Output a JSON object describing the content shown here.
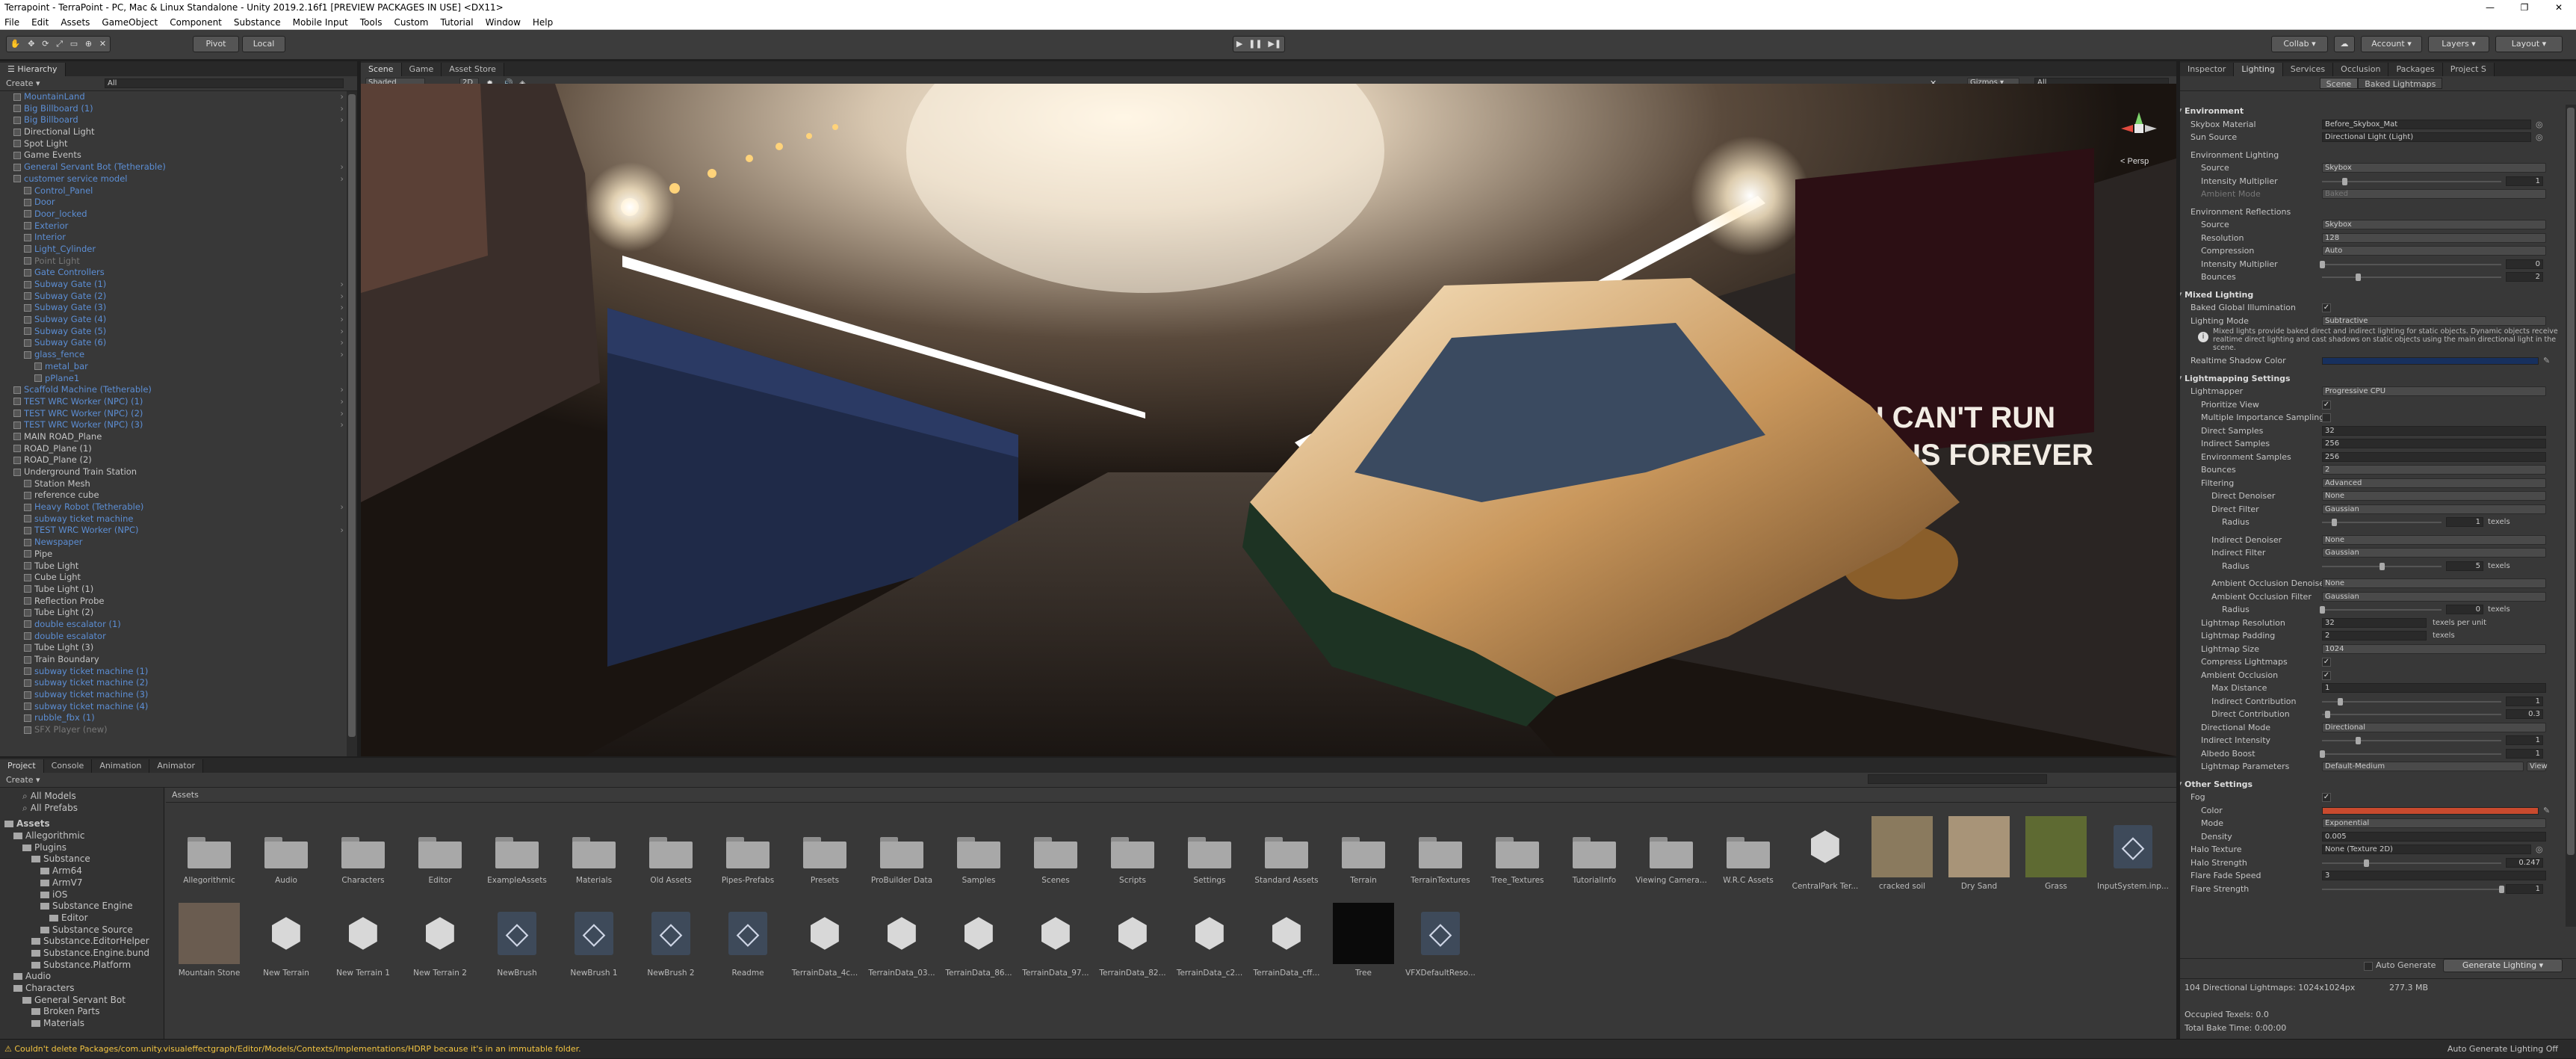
{
  "window": {
    "title": "Terrapoint - TerraPoint - PC, Mac & Linux Standalone - Unity 2019.2.16f1 [PREVIEW PACKAGES IN USE] <DX11>",
    "minimize": "—",
    "maximize": "❐",
    "close": "✕"
  },
  "menu": [
    "File",
    "Edit",
    "Assets",
    "GameObject",
    "Component",
    "Substance",
    "Mobile Input",
    "Tools",
    "Custom",
    "Tutorial",
    "Window",
    "Help"
  ],
  "toolbar": {
    "pivot": "Pivot",
    "local": "Local",
    "collab": "Collab ▾",
    "account": "Account ▾",
    "layers": "Layers ▾",
    "layout": "Layout ▾"
  },
  "hierarchy": {
    "tab": "Hierarchy",
    "create": "Create ▾",
    "search_placeholder": "All",
    "rows": [
      {
        "t": "MountainLand",
        "s": "blue",
        "d": 1,
        "arr": true
      },
      {
        "t": "Big Billboard (1)",
        "s": "blue",
        "d": 1,
        "arr": true
      },
      {
        "t": "Big Billboard",
        "s": "blue",
        "d": 1,
        "arr": true
      },
      {
        "t": "Directional Light",
        "s": "",
        "d": 1
      },
      {
        "t": "Spot Light",
        "s": "",
        "d": 1
      },
      {
        "t": "Game Events",
        "s": "",
        "d": 1
      },
      {
        "t": "General Servant Bot (Tetherable)",
        "s": "blue",
        "d": 1,
        "arr": true
      },
      {
        "t": "customer service model",
        "s": "blue",
        "d": 1,
        "arr": true
      },
      {
        "t": "Control_Panel",
        "s": "blue",
        "d": 2
      },
      {
        "t": "Door",
        "s": "blue",
        "d": 2
      },
      {
        "t": "Door_locked",
        "s": "blue",
        "d": 2
      },
      {
        "t": "Exterior",
        "s": "blue",
        "d": 2
      },
      {
        "t": "Interior",
        "s": "blue",
        "d": 2
      },
      {
        "t": "Light_Cylinder",
        "s": "blue",
        "d": 2
      },
      {
        "t": "Point Light",
        "s": "dim",
        "d": 2
      },
      {
        "t": "Gate Controllers",
        "s": "blue",
        "d": 2
      },
      {
        "t": "Subway Gate (1)",
        "s": "blue",
        "d": 2,
        "arr": true
      },
      {
        "t": "Subway Gate (2)",
        "s": "blue",
        "d": 2,
        "arr": true
      },
      {
        "t": "Subway Gate (3)",
        "s": "blue",
        "d": 2,
        "arr": true
      },
      {
        "t": "Subway Gate (4)",
        "s": "blue",
        "d": 2,
        "arr": true
      },
      {
        "t": "Subway Gate (5)",
        "s": "blue",
        "d": 2,
        "arr": true
      },
      {
        "t": "Subway Gate (6)",
        "s": "blue",
        "d": 2,
        "arr": true
      },
      {
        "t": "glass_fence",
        "s": "blue",
        "d": 2,
        "arr": true
      },
      {
        "t": "metal_bar",
        "s": "blue",
        "d": 3
      },
      {
        "t": "pPlane1",
        "s": "blue",
        "d": 3
      },
      {
        "t": "Scaffold Machine (Tetherable)",
        "s": "blue",
        "d": 1,
        "arr": true
      },
      {
        "t": "TEST WRC Worker (NPC) (1)",
        "s": "blue",
        "d": 1,
        "arr": true
      },
      {
        "t": "TEST WRC Worker (NPC) (2)",
        "s": "blue",
        "d": 1,
        "arr": true
      },
      {
        "t": "TEST WRC Worker (NPC) (3)",
        "s": "blue",
        "d": 1,
        "arr": true
      },
      {
        "t": "MAIN ROAD_Plane",
        "s": "",
        "d": 1
      },
      {
        "t": "ROAD_Plane (1)",
        "s": "",
        "d": 1
      },
      {
        "t": "ROAD_Plane (2)",
        "s": "",
        "d": 1
      },
      {
        "t": "Underground Train Station",
        "s": "",
        "d": 1
      },
      {
        "t": "Station Mesh",
        "s": "",
        "d": 2
      },
      {
        "t": "reference cube",
        "s": "",
        "d": 2
      },
      {
        "t": "Heavy Robot (Tetherable)",
        "s": "blue",
        "d": 2,
        "arr": true
      },
      {
        "t": "subway ticket machine",
        "s": "blue",
        "d": 2
      },
      {
        "t": "TEST WRC Worker (NPC)",
        "s": "blue",
        "d": 2,
        "arr": true
      },
      {
        "t": "Newspaper",
        "s": "blue",
        "d": 2
      },
      {
        "t": "Pipe",
        "s": "",
        "d": 2
      },
      {
        "t": "Tube Light",
        "s": "",
        "d": 2
      },
      {
        "t": "Cube Light",
        "s": "",
        "d": 2
      },
      {
        "t": "Tube Light (1)",
        "s": "",
        "d": 2
      },
      {
        "t": "Reflection Probe",
        "s": "",
        "d": 2
      },
      {
        "t": "Tube Light (2)",
        "s": "",
        "d": 2
      },
      {
        "t": "double escalator (1)",
        "s": "blue",
        "d": 2
      },
      {
        "t": "double escalator",
        "s": "blue",
        "d": 2
      },
      {
        "t": "Tube Light (3)",
        "s": "",
        "d": 2
      },
      {
        "t": "Train Boundary",
        "s": "",
        "d": 2
      },
      {
        "t": "subway ticket machine (1)",
        "s": "blue",
        "d": 2
      },
      {
        "t": "subway ticket machine (2)",
        "s": "blue",
        "d": 2
      },
      {
        "t": "subway ticket machine (3)",
        "s": "blue",
        "d": 2
      },
      {
        "t": "subway ticket machine (4)",
        "s": "blue",
        "d": 2
      },
      {
        "t": "rubble_fbx (1)",
        "s": "blue",
        "d": 2
      },
      {
        "t": "SFX Player (new)",
        "s": "dim",
        "d": 2
      }
    ]
  },
  "scene": {
    "tabs": [
      "Scene",
      "Game",
      "Asset Store"
    ],
    "shaded": "Shaded",
    "mode_2d": "2D",
    "gizmos": "Gizmos ▾",
    "search_placeholder": "All",
    "persp": "< Persp",
    "billboard_line1": "YOU CAN'T RUN",
    "billboard_line2": "FROM US FOREVER"
  },
  "project": {
    "tabs": [
      "Project",
      "Console",
      "Animation",
      "Animator"
    ],
    "create": "Create ▾",
    "favorites": [
      "All Models",
      "All Prefabs"
    ],
    "tree": [
      {
        "t": "Assets",
        "d": 0,
        "b": true
      },
      {
        "t": "Allegorithmic",
        "d": 1
      },
      {
        "t": "Plugins",
        "d": 2
      },
      {
        "t": "Substance",
        "d": 3
      },
      {
        "t": "Arm64",
        "d": 4
      },
      {
        "t": "ArmV7",
        "d": 4
      },
      {
        "t": "iOS",
        "d": 4
      },
      {
        "t": "Substance Engine",
        "d": 4
      },
      {
        "t": "Editor",
        "d": 5
      },
      {
        "t": "Substance Source",
        "d": 4
      },
      {
        "t": "Substance.EditorHelper",
        "d": 3
      },
      {
        "t": "Substance.Engine.bund",
        "d": 3
      },
      {
        "t": "Substance.Platform",
        "d": 3
      },
      {
        "t": "Audio",
        "d": 1
      },
      {
        "t": "Characters",
        "d": 1
      },
      {
        "t": "General Servant Bot",
        "d": 2
      },
      {
        "t": "Broken Parts",
        "d": 3
      },
      {
        "t": "Materials",
        "d": 3
      }
    ],
    "breadcrumb": "Assets",
    "assets_row1": [
      {
        "n": "Allegorithmic",
        "k": "folder"
      },
      {
        "n": "Audio",
        "k": "folder"
      },
      {
        "n": "Characters",
        "k": "folder"
      },
      {
        "n": "Editor",
        "k": "folder"
      },
      {
        "n": "ExampleAssets",
        "k": "folder"
      },
      {
        "n": "Materials",
        "k": "folder"
      },
      {
        "n": "Old Assets",
        "k": "folder"
      },
      {
        "n": "Pipes-Prefabs",
        "k": "folder"
      },
      {
        "n": "Presets",
        "k": "folder"
      },
      {
        "n": "ProBuilder Data",
        "k": "folder"
      },
      {
        "n": "Samples",
        "k": "folder"
      },
      {
        "n": "Scenes",
        "k": "folder"
      },
      {
        "n": "Scripts",
        "k": "folder"
      },
      {
        "n": "Settings",
        "k": "folder"
      },
      {
        "n": "Standard Assets",
        "k": "folder"
      },
      {
        "n": "Terrain",
        "k": "folder"
      },
      {
        "n": "TerrainTextures",
        "k": "folder"
      },
      {
        "n": "Tree_Textures",
        "k": "folder"
      },
      {
        "n": "TutorialInfo",
        "k": "folder"
      },
      {
        "n": "Viewing Camera...",
        "k": "folder"
      },
      {
        "n": "W.R.C Assets",
        "k": "folder"
      },
      {
        "n": "CentralPark Ter...",
        "k": "cube"
      },
      {
        "n": "cracked soil",
        "k": "soil"
      },
      {
        "n": "Dry Sand",
        "k": "sand"
      },
      {
        "n": "Grass",
        "k": "grass"
      },
      {
        "n": "InputSystem.inp...",
        "k": "unity"
      }
    ],
    "assets_row2": [
      {
        "n": "Mountain Stone",
        "k": "stone"
      },
      {
        "n": "New Terrain",
        "k": "cube"
      },
      {
        "n": "New Terrain 1",
        "k": "cube"
      },
      {
        "n": "New Terrain 2",
        "k": "cube"
      },
      {
        "n": "NewBrush",
        "k": "unity"
      },
      {
        "n": "NewBrush 1",
        "k": "unity"
      },
      {
        "n": "NewBrush 2",
        "k": "unity"
      },
      {
        "n": "Readme",
        "k": "unity"
      },
      {
        "n": "TerrainData_4c...",
        "k": "cube"
      },
      {
        "n": "TerrainData_03...",
        "k": "cube"
      },
      {
        "n": "TerrainData_86...",
        "k": "cube"
      },
      {
        "n": "TerrainData_97...",
        "k": "cube"
      },
      {
        "n": "TerrainData_82...",
        "k": "cube"
      },
      {
        "n": "TerrainData_c2...",
        "k": "cube"
      },
      {
        "n": "TerrainData_cff...",
        "k": "cube"
      },
      {
        "n": "Tree",
        "k": "black"
      },
      {
        "n": "VFXDefaultReso...",
        "k": "unity"
      }
    ]
  },
  "inspector": {
    "tabs": [
      "Inspector",
      "Lighting",
      "Services",
      "Occlusion",
      "Packages",
      "Project S"
    ],
    "subtabs": [
      "Scene",
      "Baked Lightmaps"
    ],
    "rows": [
      {
        "k": "h",
        "t": "Environment"
      },
      {
        "k": "r",
        "t": "Skybox Material",
        "v": "Before_Skybox_Mat",
        "ctl": "obj"
      },
      {
        "k": "r",
        "t": "Sun Source",
        "v": "Directional Light (Light)",
        "ctl": "obj"
      },
      {
        "k": "g"
      },
      {
        "k": "s",
        "t": "Environment Lighting"
      },
      {
        "k": "r",
        "i": 1,
        "t": "Source",
        "v": "Skybox",
        "ctl": "dd"
      },
      {
        "k": "r",
        "i": 1,
        "t": "Intensity Multiplier",
        "v": "1",
        "ctl": "sl",
        "p": 0.125
      },
      {
        "k": "r",
        "i": 1,
        "t": "Ambient Mode",
        "v": "Baked",
        "ctl": "dd",
        "dim": true
      },
      {
        "k": "g"
      },
      {
        "k": "s",
        "t": "Environment Reflections"
      },
      {
        "k": "r",
        "i": 1,
        "t": "Source",
        "v": "Skybox",
        "ctl": "dd"
      },
      {
        "k": "r",
        "i": 1,
        "t": "Resolution",
        "v": "128",
        "ctl": "dd"
      },
      {
        "k": "r",
        "i": 1,
        "t": "Compression",
        "v": "Auto",
        "ctl": "dd"
      },
      {
        "k": "r",
        "i": 1,
        "t": "Intensity Multiplier",
        "v": "0",
        "ctl": "sl",
        "p": 0.0
      },
      {
        "k": "r",
        "i": 1,
        "t": "Bounces",
        "v": "2",
        "ctl": "sl",
        "p": 0.2
      },
      {
        "k": "g"
      },
      {
        "k": "h",
        "t": "Mixed Lighting"
      },
      {
        "k": "r",
        "t": "Baked Global Illumination",
        "v": "✓",
        "ctl": "chk"
      },
      {
        "k": "r",
        "t": "Lighting Mode",
        "v": "Subtractive",
        "ctl": "dd"
      },
      {
        "k": "info",
        "t": "Mixed lights provide baked direct and indirect lighting for static objects. Dynamic objects receive realtime direct lighting and cast shadows on static objects using the main directional light in the scene."
      },
      {
        "k": "r",
        "t": "Realtime Shadow Color",
        "v": "",
        "ctl": "color",
        "c": "#17305e"
      },
      {
        "k": "g"
      },
      {
        "k": "h",
        "t": "Lightmapping Settings"
      },
      {
        "k": "r",
        "t": "Lightmapper",
        "v": "Progressive CPU",
        "ctl": "dd"
      },
      {
        "k": "r",
        "i": 1,
        "t": "Prioritize View",
        "v": "✓",
        "ctl": "chk"
      },
      {
        "k": "r",
        "i": 1,
        "t": "Multiple Importance Sampling",
        "v": "",
        "ctl": "chk"
      },
      {
        "k": "r",
        "i": 1,
        "t": "Direct Samples",
        "v": "32",
        "ctl": "fld"
      },
      {
        "k": "r",
        "i": 1,
        "t": "Indirect Samples",
        "v": "256",
        "ctl": "fld"
      },
      {
        "k": "r",
        "i": 1,
        "t": "Environment Samples",
        "v": "256",
        "ctl": "fld"
      },
      {
        "k": "r",
        "i": 1,
        "t": "Bounces",
        "v": "2",
        "ctl": "dd"
      },
      {
        "k": "r",
        "i": 1,
        "t": "Filtering",
        "v": "Advanced",
        "ctl": "dd"
      },
      {
        "k": "r",
        "i": 2,
        "t": "Direct Denoiser",
        "v": "None",
        "ctl": "dd"
      },
      {
        "k": "r",
        "i": 2,
        "t": "Direct Filter",
        "v": "Gaussian",
        "ctl": "dd"
      },
      {
        "k": "r",
        "i": 3,
        "t": "Radius",
        "v": "1",
        "ctl": "slu",
        "p": 0.1,
        "u": "texels"
      },
      {
        "k": "g"
      },
      {
        "k": "r",
        "i": 2,
        "t": "Indirect Denoiser",
        "v": "None",
        "ctl": "dd"
      },
      {
        "k": "r",
        "i": 2,
        "t": "Indirect Filter",
        "v": "Gaussian",
        "ctl": "dd"
      },
      {
        "k": "r",
        "i": 3,
        "t": "Radius",
        "v": "5",
        "ctl": "slu",
        "p": 0.5,
        "u": "texels"
      },
      {
        "k": "g"
      },
      {
        "k": "r",
        "i": 2,
        "t": "Ambient Occlusion Denoiser",
        "v": "None",
        "ctl": "dd"
      },
      {
        "k": "r",
        "i": 2,
        "t": "Ambient Occlusion Filter",
        "v": "Gaussian",
        "ctl": "dd"
      },
      {
        "k": "r",
        "i": 3,
        "t": "Radius",
        "v": "0",
        "ctl": "slu",
        "p": 0.0,
        "u": "texels"
      },
      {
        "k": "r",
        "i": 1,
        "t": "Lightmap Resolution",
        "v": "32",
        "ctl": "fldu",
        "u": "texels per unit"
      },
      {
        "k": "r",
        "i": 1,
        "t": "Lightmap Padding",
        "v": "2",
        "ctl": "fldu",
        "u": "texels"
      },
      {
        "k": "r",
        "i": 1,
        "t": "Lightmap Size",
        "v": "1024",
        "ctl": "dd"
      },
      {
        "k": "r",
        "i": 1,
        "t": "Compress Lightmaps",
        "v": "✓",
        "ctl": "chk"
      },
      {
        "k": "r",
        "i": 1,
        "t": "Ambient Occlusion",
        "v": "✓",
        "ctl": "chk"
      },
      {
        "k": "r",
        "i": 2,
        "t": "Max Distance",
        "v": "1",
        "ctl": "fld"
      },
      {
        "k": "r",
        "i": 2,
        "t": "Indirect Contribution",
        "v": "1",
        "ctl": "sl",
        "p": 0.1
      },
      {
        "k": "r",
        "i": 2,
        "t": "Direct Contribution",
        "v": "0.3",
        "ctl": "sl",
        "p": 0.03
      },
      {
        "k": "r",
        "i": 1,
        "t": "Directional Mode",
        "v": "Directional",
        "ctl": "dd"
      },
      {
        "k": "r",
        "i": 1,
        "t": "Indirect Intensity",
        "v": "1",
        "ctl": "sl",
        "p": 0.2
      },
      {
        "k": "r",
        "i": 1,
        "t": "Albedo Boost",
        "v": "1",
        "ctl": "sl",
        "p": 0.0
      },
      {
        "k": "r",
        "i": 1,
        "t": "Lightmap Parameters",
        "v": "Default-Medium",
        "ctl": "ddv"
      },
      {
        "k": "g"
      },
      {
        "k": "h",
        "t": "Other Settings"
      },
      {
        "k": "r",
        "t": "Fog",
        "v": "✓",
        "ctl": "chk"
      },
      {
        "k": "r",
        "i": 1,
        "t": "Color",
        "v": "",
        "ctl": "color",
        "c": "#c94a2e"
      },
      {
        "k": "r",
        "i": 1,
        "t": "Mode",
        "v": "Exponential",
        "ctl": "dd"
      },
      {
        "k": "r",
        "i": 1,
        "t": "Density",
        "v": "0.005",
        "ctl": "fld"
      },
      {
        "k": "r",
        "t": "Halo Texture",
        "v": "None (Texture 2D)",
        "ctl": "obj"
      },
      {
        "k": "r",
        "t": "Halo Strength",
        "v": "0.247",
        "ctl": "sl",
        "p": 0.247
      },
      {
        "k": "r",
        "t": "Flare Fade Speed",
        "v": "3",
        "ctl": "fld"
      },
      {
        "k": "r",
        "t": "Flare Strength",
        "v": "1",
        "ctl": "sl",
        "p": 1.0
      }
    ],
    "auto_generate": "Auto Generate",
    "generate_lighting": "Generate Lighting ▾",
    "stats1": "104 Directional Lightmaps: 1024x1024px",
    "stats1_size": "277.3 MB",
    "stats2": "Occupied Texels: 0.0",
    "stats3": "Total Bake Time: 0:00:00"
  },
  "status": {
    "message": "Couldn't delete Packages/com.unity.visualeffectgraph/Editor/Models/Contexts/Implementations/HDRP because it's in an immutable folder.",
    "right": "Auto Generate Lighting Off"
  },
  "colors": {
    "link_blue": "#5c8ed4",
    "panel_bg": "#383838",
    "fog_color": "#c94a2e",
    "shadow_color": "#17305e"
  }
}
